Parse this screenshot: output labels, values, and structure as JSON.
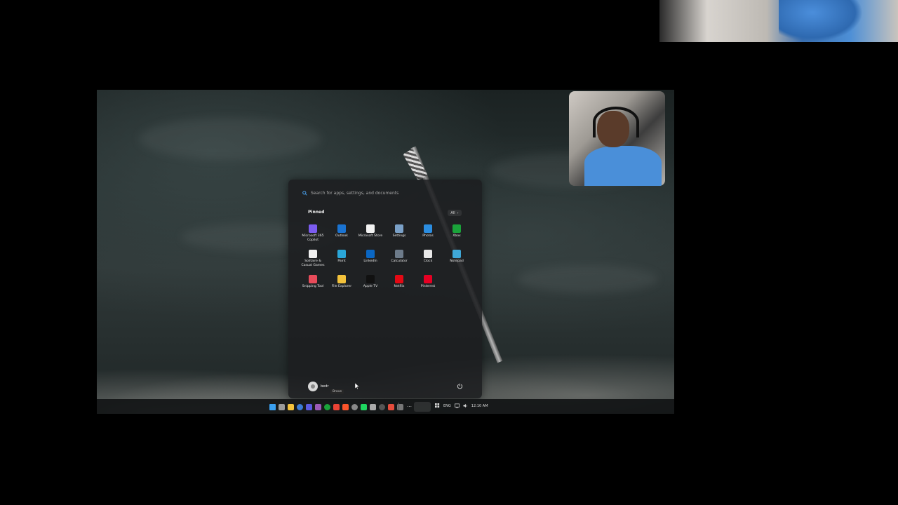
{
  "search": {
    "placeholder": "Search for apps, settings, and documents"
  },
  "pinned": {
    "label": "Pinned",
    "all_label": "All",
    "apps": [
      {
        "id": "m365",
        "label": "Microsoft 365 Copilot",
        "icon": "copilot-icon",
        "color": "#7b5cf0"
      },
      {
        "id": "outlook",
        "label": "Outlook",
        "icon": "outlook-icon",
        "color": "#1a73d1"
      },
      {
        "id": "store",
        "label": "Microsoft Store",
        "icon": "store-icon",
        "color": "#f2f2f2"
      },
      {
        "id": "settings",
        "label": "Settings",
        "icon": "gear-icon",
        "color": "#7aa0c7"
      },
      {
        "id": "photos",
        "label": "Photos",
        "icon": "photos-icon",
        "color": "#2b8de0"
      },
      {
        "id": "xbox",
        "label": "Xbox",
        "icon": "xbox-icon",
        "color": "#1aa33a"
      },
      {
        "id": "solitaire",
        "label": "Solitaire & Casual Games",
        "icon": "solitaire-icon",
        "color": "#f0f0f0"
      },
      {
        "id": "paint",
        "label": "Paint",
        "icon": "paint-icon",
        "color": "#2aa6d8"
      },
      {
        "id": "linkedin",
        "label": "LinkedIn",
        "icon": "linkedin-icon",
        "color": "#0a66c2"
      },
      {
        "id": "calculator",
        "label": "Calculator",
        "icon": "calculator-icon",
        "color": "#6d7b8a"
      },
      {
        "id": "clock",
        "label": "Clock",
        "icon": "clock-icon",
        "color": "#e8e8e8"
      },
      {
        "id": "notepad",
        "label": "Notepad",
        "icon": "notepad-icon",
        "color": "#3fa8d8"
      },
      {
        "id": "snipping",
        "label": "Snipping Tool",
        "icon": "snipping-icon",
        "color": "#e84b5a"
      },
      {
        "id": "explorer",
        "label": "File Explorer",
        "icon": "folder-icon",
        "color": "#f3c23b"
      },
      {
        "id": "appletv",
        "label": "Apple TV",
        "icon": "appletv-icon",
        "color": "#111111"
      },
      {
        "id": "netflix",
        "label": "Netflix",
        "icon": "netflix-icon",
        "color": "#e50914"
      },
      {
        "id": "pinterest",
        "label": "Pinterest",
        "icon": "pinterest-icon",
        "color": "#e60023"
      }
    ]
  },
  "user": {
    "name": "bedr",
    "tooltip": "Brave"
  },
  "taskbar": {
    "icon_colors": [
      "#3aa0f0",
      "#9a9a9a",
      "#f3c23b",
      "#3a7bd5",
      "#5a5ae0",
      "#9b59b6",
      "#1aa33a",
      "#ea4335",
      "#fb542b",
      "#888888",
      "#1ed760",
      "#aaaaaa",
      "#555555",
      "#e74c3c",
      "#777777"
    ],
    "more_label": "…"
  },
  "tray": {
    "language": "ENG",
    "time": "12:10 AM"
  }
}
